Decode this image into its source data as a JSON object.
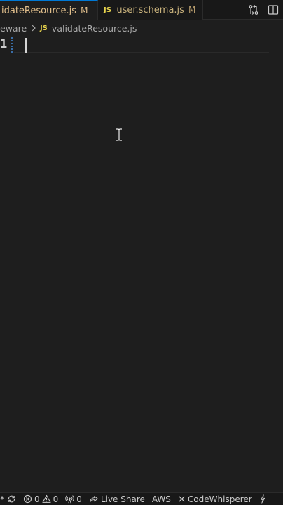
{
  "tabs": [
    {
      "name": "idateResource.js",
      "badge": "M",
      "badge_icon": "js-icon",
      "dirty": true,
      "active": true
    },
    {
      "name": "user.schema.js",
      "badge": "M",
      "badge_icon": "js-icon",
      "dirty": false,
      "active": false
    }
  ],
  "js_label": "JS",
  "tab_actions": [
    "compare-changes-icon",
    "split-editor-icon"
  ],
  "breadcrumb": {
    "folder": "eware",
    "file": "validateResource.js"
  },
  "editor": {
    "line_numbers": [
      "1"
    ],
    "content": ""
  },
  "statusbar": {
    "remote": "*",
    "errors": "0",
    "warnings": "0",
    "ports": "0",
    "live_share": "Live Share",
    "aws": "AWS",
    "codewhisperer": "CodeWhisperer"
  },
  "colors": {
    "modified": "#e2c08d",
    "js_yellow": "#e8d44d",
    "accent": "#0078d4",
    "editor_bg": "#1e1e1e",
    "chrome_bg": "#181818"
  }
}
